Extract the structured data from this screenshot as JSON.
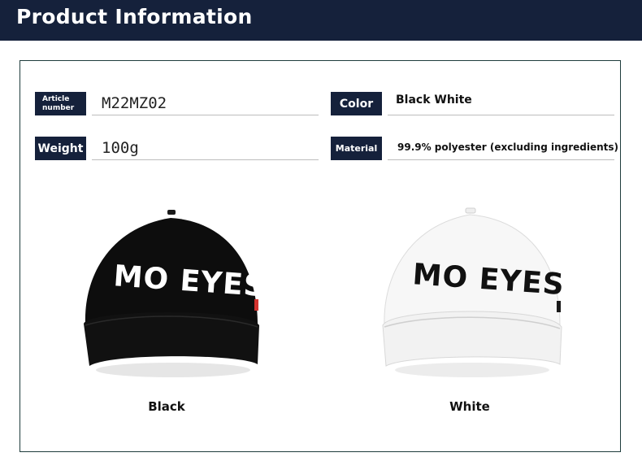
{
  "header": {
    "title": "Product Information"
  },
  "specs": {
    "article_label_line1": "Article",
    "article_label_line2": "number",
    "article_value": "M22MZ02",
    "color_label": "Color",
    "color_value": "Black White",
    "weight_label": "Weight",
    "weight_value": "100g",
    "material_label": "Material",
    "material_value": "99.9% polyester (excluding ingredients)"
  },
  "products": [
    {
      "caption": "Black",
      "logo_text": "MO EYES",
      "cap_color": "#0d0d0d",
      "logo_color": "#ffffff"
    },
    {
      "caption": "White",
      "logo_text": "MO EYES",
      "cap_color": "#f7f7f7",
      "logo_color": "#111111"
    }
  ],
  "colors": {
    "header_bg": "#15213b",
    "label_bg": "#15213b",
    "panel_border": "#1f3c3c"
  }
}
